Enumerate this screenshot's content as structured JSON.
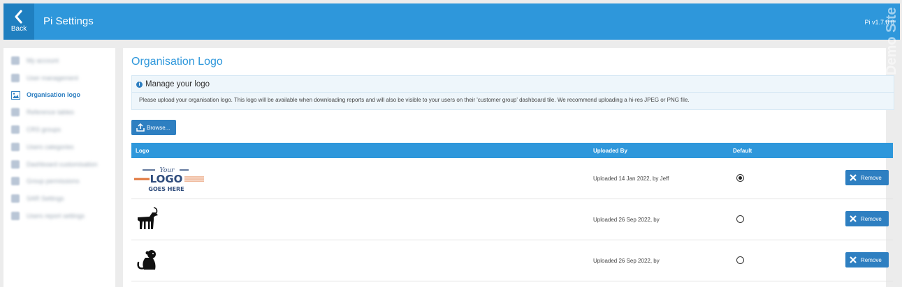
{
  "header": {
    "back_label": "Back",
    "title": "Pi Settings",
    "version": "Pi v1.7.8.0",
    "watermark": "Demo Site"
  },
  "sidebar": {
    "items": [
      {
        "label": "My account",
        "icon": "user-icon",
        "active": false
      },
      {
        "label": "User management",
        "icon": "users-icon",
        "active": false
      },
      {
        "label": "Organisation logo",
        "icon": "image-icon",
        "active": true
      },
      {
        "label": "Reference tables",
        "icon": "table-icon",
        "active": false
      },
      {
        "label": "CRS groups",
        "icon": "group-icon",
        "active": false
      },
      {
        "label": "Users categories",
        "icon": "grid-icon",
        "active": false
      },
      {
        "label": "Dashboard customisation",
        "icon": "pen-icon",
        "active": false
      },
      {
        "label": "Group permissions",
        "icon": "grid-icon",
        "active": false
      },
      {
        "label": "SAR Settings",
        "icon": "doc-icon",
        "active": false
      },
      {
        "label": "Users report settings",
        "icon": "grid-icon",
        "active": false
      }
    ]
  },
  "main": {
    "title": "Organisation Logo",
    "info": {
      "title": "Manage your logo",
      "text": "Please upload your organisation logo. This logo will be available when downloading reports and will also be visible to your users on their 'customer group' dashboard tile. We recommend uploading a hi-res JPEG or PNG file."
    },
    "browse_label": "Browse...",
    "table": {
      "headers": {
        "logo": "Logo",
        "uploaded_by": "Uploaded By",
        "default": "Default"
      },
      "rows": [
        {
          "logo": "your-logo-placeholder",
          "uploaded": "Uploaded 14 Jan 2022, by Jeff",
          "default": true,
          "remove_label": "Remove"
        },
        {
          "logo": "antelope-icon",
          "uploaded": "Uploaded 26 Sep 2022, by",
          "default": false,
          "remove_label": "Remove"
        },
        {
          "logo": "monkey-icon",
          "uploaded": "Uploaded 26 Sep 2022, by",
          "default": false,
          "remove_label": "Remove"
        }
      ]
    },
    "logo_text": {
      "your": "Your",
      "logo": "LOGO",
      "goes_here": "GOES HERE"
    }
  },
  "colors": {
    "primary": "#2e97db",
    "button": "#2e7fc1",
    "background": "#ececec"
  }
}
